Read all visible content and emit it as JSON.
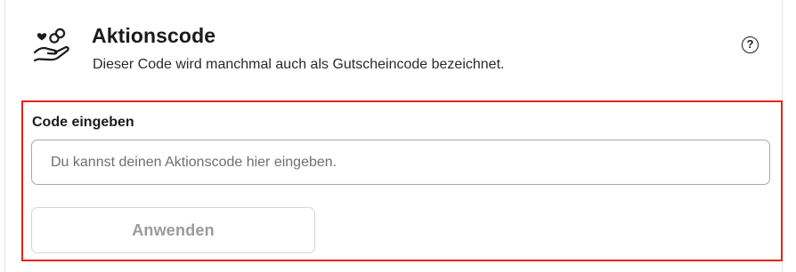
{
  "promo": {
    "icon": "hand-with-coin-and-heart-icon",
    "title": "Aktionscode",
    "subtitle": "Dieser Code wird manchmal auch als Gutscheincode bezeichnet.",
    "help_icon": "question-circle-icon",
    "help_symbol": "?"
  },
  "form": {
    "label": "Code eingeben",
    "input_value": "",
    "placeholder": "Du kannst deinen Aktionscode hier eingeben.",
    "apply_label": "Anwenden",
    "apply_state": "disabled"
  },
  "colors": {
    "text": "#1b1b1b",
    "highlight_border": "#e8231a",
    "disabled_text": "#9b9b9b",
    "input_border": "#a9a9a9"
  }
}
